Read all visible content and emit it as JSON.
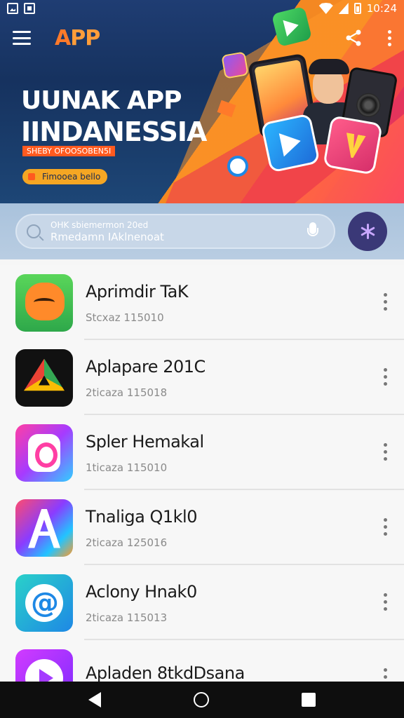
{
  "status_bar": {
    "time": "10:24",
    "left_icons": [
      "image-notification-icon",
      "document-notification-icon"
    ],
    "right_icons": [
      "wifi-icon",
      "signal-icon",
      "battery-icon"
    ]
  },
  "toolbar": {
    "logo_first": "A",
    "logo_rest": "PP",
    "menu_icon": "hamburger-menu-icon",
    "share_icon": "share-icon",
    "more_icon": "more-vertical-icon"
  },
  "hero": {
    "title_line1": "UUNAK APP",
    "title_line2": "IINDANESSIA",
    "tagline": "SHEBY OFOOSOBEN5I",
    "button_label": "Fimooea bello"
  },
  "search": {
    "hint": "OHK sbiemermon 20ed",
    "value": "Rmedamn IAklnenoat",
    "mic_icon": "microphone-icon",
    "action_icon": "sparkle-icon"
  },
  "apps": [
    {
      "name": "Aprimdir TaK",
      "meta": "Stcxaz 115010",
      "icon": "cat-app-icon"
    },
    {
      "name": "Aplapare 201C",
      "meta": "2ticaza 115018",
      "icon": "drive-app-icon"
    },
    {
      "name": "Spler Hemakal",
      "meta": "1ticaza 115010",
      "icon": "snap-app-icon"
    },
    {
      "name": "Tnaliga Q1kl0",
      "meta": "2ticaza 125016",
      "icon": "letter-a-app-icon"
    },
    {
      "name": "Aclony Hnak0",
      "meta": "2ticaza 115013",
      "icon": "at-sign-app-icon"
    },
    {
      "name": "Apladen 8tkdDsana",
      "meta": "",
      "icon": "play-app-icon"
    }
  ],
  "nav": {
    "back_icon": "back-icon",
    "home_icon": "home-icon",
    "recents_icon": "recents-icon"
  },
  "colors": {
    "header_blue": "#1f3d73",
    "accent_orange": "#ff7a2a",
    "voice_button": "#3a3877",
    "search_bg": "#a9c2dc"
  }
}
